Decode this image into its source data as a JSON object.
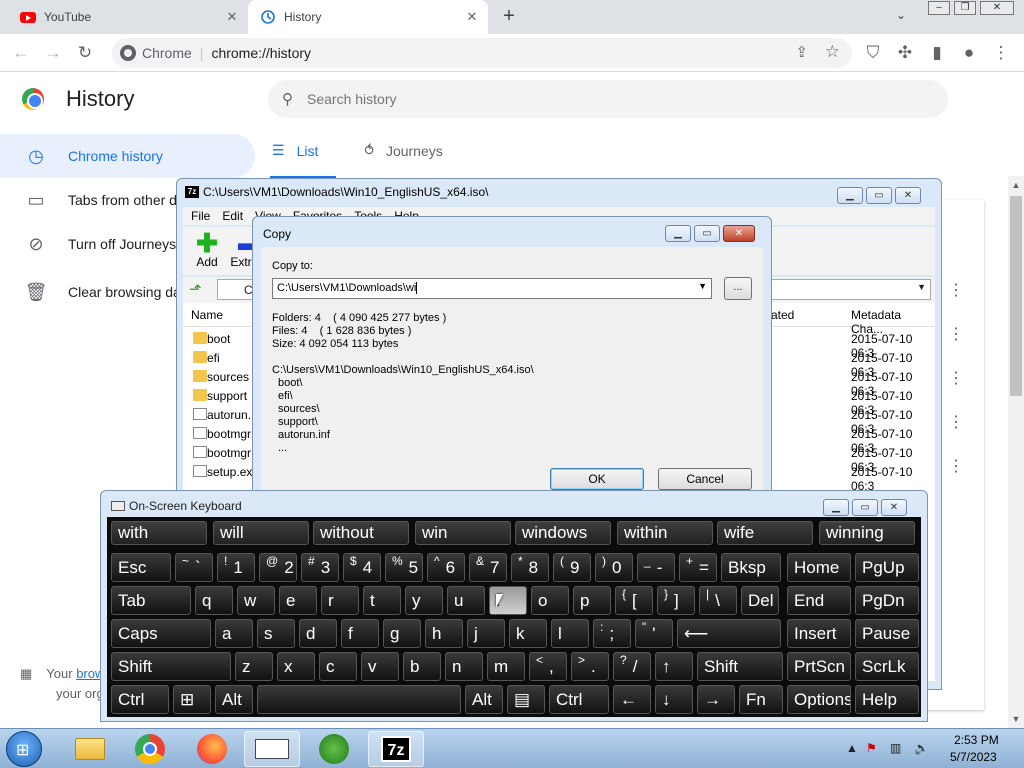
{
  "tabs": [
    {
      "title": "YouTube"
    },
    {
      "title": "History"
    }
  ],
  "omnibox": {
    "site": "Chrome",
    "url": "chrome://history"
  },
  "history": {
    "title": "History",
    "search_placeholder": "Search history",
    "sidebar": [
      {
        "label": "Chrome history",
        "icon": "clock-icon"
      },
      {
        "label": "Tabs from other devices",
        "icon": "devices-icon"
      },
      {
        "label": "Turn off Journeys",
        "icon": "journeys-off-icon"
      },
      {
        "label": "Clear browsing data",
        "icon": "trash-icon"
      }
    ],
    "tabs": [
      {
        "label": "List",
        "icon": "list-icon"
      },
      {
        "label": "Journeys",
        "icon": "journeys-icon"
      }
    ],
    "managed_text_1": "Your",
    "managed_link": "browser is managed",
    "managed_text_2": "your org"
  },
  "sevenzip": {
    "title": "C:\\Users\\VM1\\Downloads\\Win10_EnglishUS_x64.iso\\",
    "menu": [
      "File",
      "Edit",
      "View",
      "Favorites",
      "Tools",
      "Help"
    ],
    "toolbar": [
      {
        "label": "Add"
      },
      {
        "label": "Extract"
      }
    ],
    "path": "C:\\",
    "columns": [
      "Name",
      "ated",
      "Metadata Cha..."
    ],
    "files": [
      {
        "name": "boot",
        "type": "folder",
        "date": "2015-07-10 06:3"
      },
      {
        "name": "efi",
        "type": "folder",
        "date": "2015-07-10 06:3"
      },
      {
        "name": "sources",
        "type": "folder",
        "date": "2015-07-10 06:3"
      },
      {
        "name": "support",
        "type": "folder",
        "date": "2015-07-10 06:3"
      },
      {
        "name": "autorun.",
        "type": "file",
        "date": "2015-07-10 06:3"
      },
      {
        "name": "bootmgr",
        "type": "file",
        "date": "2015-07-10 06:3"
      },
      {
        "name": "bootmgr",
        "type": "file",
        "date": "2015-07-10 06:3"
      },
      {
        "name": "setup.ex",
        "type": "file",
        "date": "2015-07-10 06:3"
      }
    ]
  },
  "copy_dialog": {
    "title": "Copy",
    "copy_to_label": "Copy to:",
    "copy_to_value": "C:\\Users\\VM1\\Downloads\\wi",
    "browse_label": "...",
    "folders_line": "Folders: 4    ( 4 090 425 277 bytes )",
    "files_line": "Files: 4    ( 1 628 836 bytes )",
    "size_line": "Size: 4 092 054 113 bytes",
    "source_path": "C:\\Users\\VM1\\Downloads\\Win10_EnglishUS_x64.iso\\",
    "items": [
      "boot\\",
      "efi\\",
      "sources\\",
      "support\\",
      "autorun.inf",
      "..."
    ],
    "ok_label": "OK",
    "cancel_label": "Cancel"
  },
  "osk": {
    "title": "On-Screen Keyboard",
    "predictions": [
      "with",
      "will",
      "without",
      "win",
      "windows",
      "within",
      "wife",
      "winning"
    ],
    "row1": [
      {
        "main": "Esc"
      },
      {
        "sub": "~",
        "main": "`"
      },
      {
        "sub": "!",
        "main": "1"
      },
      {
        "sub": "@",
        "main": "2"
      },
      {
        "sub": "#",
        "main": "3"
      },
      {
        "sub": "$",
        "main": "4"
      },
      {
        "sub": "%",
        "main": "5"
      },
      {
        "sub": "^",
        "main": "6"
      },
      {
        "sub": "&",
        "main": "7"
      },
      {
        "sub": "*",
        "main": "8"
      },
      {
        "sub": "(",
        "main": "9"
      },
      {
        "sub": ")",
        "main": "0"
      },
      {
        "sub": "_",
        "main": "-"
      },
      {
        "sub": "+",
        "main": "="
      },
      {
        "main": "Bksp"
      },
      {
        "main": "Home"
      },
      {
        "main": "PgUp"
      }
    ],
    "row2": [
      {
        "main": "Tab"
      },
      {
        "main": "q"
      },
      {
        "main": "w"
      },
      {
        "main": "e"
      },
      {
        "main": "r"
      },
      {
        "main": "t"
      },
      {
        "main": "y"
      },
      {
        "main": "u"
      },
      {
        "main": "i"
      },
      {
        "main": "o"
      },
      {
        "main": "p"
      },
      {
        "sub": "{",
        "main": "["
      },
      {
        "sub": "}",
        "main": "]"
      },
      {
        "sub": "|",
        "main": "\\"
      },
      {
        "main": "Del"
      },
      {
        "main": "End"
      },
      {
        "main": "PgDn"
      }
    ],
    "row3": [
      {
        "main": "Caps"
      },
      {
        "main": "a"
      },
      {
        "main": "s"
      },
      {
        "main": "d"
      },
      {
        "main": "f"
      },
      {
        "main": "g"
      },
      {
        "main": "h"
      },
      {
        "main": "j"
      },
      {
        "main": "k"
      },
      {
        "main": "l"
      },
      {
        "sub": ":",
        "main": ";"
      },
      {
        "sub": "\"",
        "main": "'"
      },
      {
        "main": "⟵"
      },
      {
        "main": "Insert"
      },
      {
        "main": "Pause"
      }
    ],
    "row4": [
      {
        "main": "Shift"
      },
      {
        "main": "z"
      },
      {
        "main": "x"
      },
      {
        "main": "c"
      },
      {
        "main": "v"
      },
      {
        "main": "b"
      },
      {
        "main": "n"
      },
      {
        "main": "m"
      },
      {
        "sub": "<",
        "main": ","
      },
      {
        "sub": ">",
        "main": "."
      },
      {
        "sub": "?",
        "main": "/"
      },
      {
        "main": "↑"
      },
      {
        "main": "Shift"
      },
      {
        "main": "PrtScn"
      },
      {
        "main": "ScrLk"
      }
    ],
    "row5": [
      {
        "main": "Ctrl"
      },
      {
        "main": "⊞"
      },
      {
        "main": "Alt"
      },
      {
        "main": ""
      },
      {
        "main": "Alt"
      },
      {
        "main": "▤"
      },
      {
        "main": "Ctrl"
      },
      {
        "main": "←"
      },
      {
        "main": "↓"
      },
      {
        "main": "→"
      },
      {
        "main": "Fn"
      },
      {
        "main": "Options"
      },
      {
        "main": "Help"
      }
    ],
    "highlighted_key": "i"
  },
  "taskbar": {
    "time": "2:53 PM",
    "date": "5/7/2023",
    "apps": [
      "explorer",
      "chrome",
      "firefox",
      "on-screen-keyboard",
      "internet-download-manager",
      "7-zip"
    ],
    "active_app": "7-zip",
    "sevenzip_label": "7z"
  }
}
